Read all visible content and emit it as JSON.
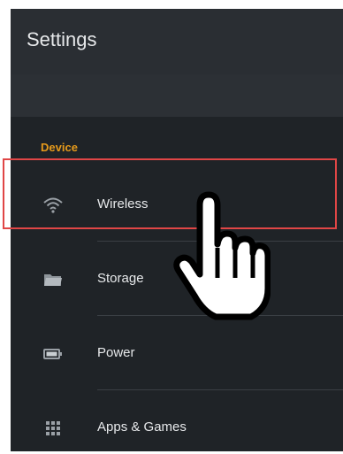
{
  "app": {
    "title": "Settings"
  },
  "section": {
    "label": "Device"
  },
  "items": [
    {
      "label": "Wireless",
      "icon": "wifi-icon"
    },
    {
      "label": "Storage",
      "icon": "folder-icon"
    },
    {
      "label": "Power",
      "icon": "battery-icon"
    },
    {
      "label": "Apps & Games",
      "icon": "grid-icon"
    }
  ],
  "colors": {
    "background": "#1f2327",
    "header": "#2a2e33",
    "accent": "#e69a1b",
    "highlight": "#e04646",
    "text": "#e7e9eb"
  },
  "pointer": {
    "icon": "hand-pointer-icon"
  }
}
